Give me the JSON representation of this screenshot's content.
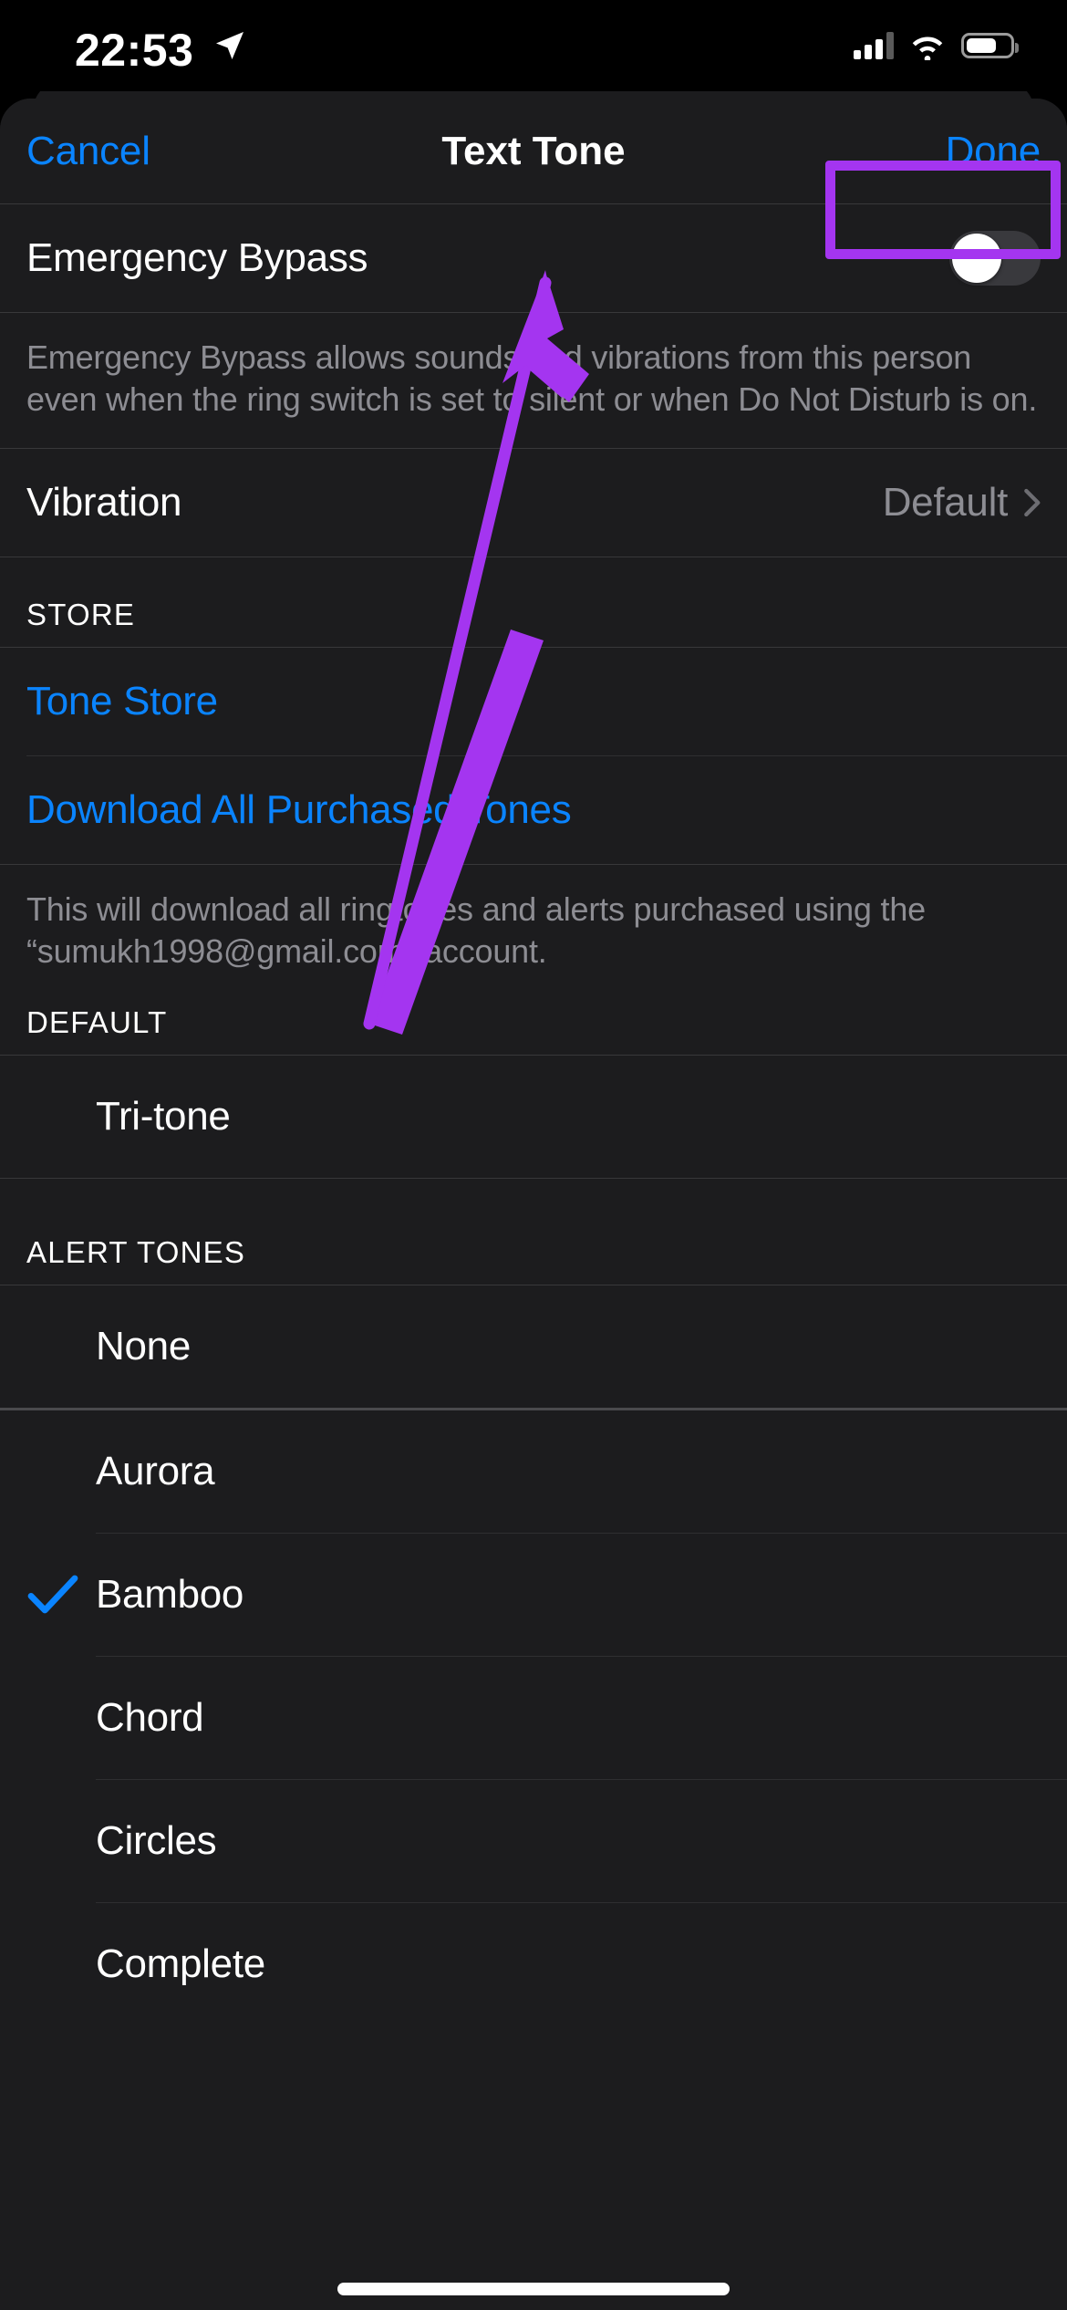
{
  "status_bar": {
    "time": "22:53",
    "location_icon": "location-arrow-icon",
    "cellular_icon": "cellular-bars-icon",
    "wifi_icon": "wifi-icon",
    "battery_icon": "battery-icon"
  },
  "nav": {
    "cancel_label": "Cancel",
    "title": "Text Tone",
    "done_label": "Done"
  },
  "emergency": {
    "label": "Emergency Bypass",
    "toggle_state": "off",
    "footer": "Emergency Bypass allows sounds and vibrations from this person even when the ring switch is set to silent or when Do Not Disturb is on."
  },
  "vibration": {
    "label": "Vibration",
    "value": "Default",
    "chevron_icon": "chevron-right-icon"
  },
  "store": {
    "header": "STORE",
    "tone_store_label": "Tone Store",
    "download_all_label": "Download All Purchased Tones",
    "footer": "This will download all ringtones and alerts purchased using the “sumukh1998@gmail.com” account."
  },
  "default_section": {
    "header": "DEFAULT",
    "items": [
      {
        "label": "Tri-tone",
        "selected": false
      }
    ]
  },
  "alert_tones": {
    "header": "ALERT TONES",
    "none_label": "None",
    "items": [
      {
        "label": "Aurora",
        "selected": false
      },
      {
        "label": "Bamboo",
        "selected": true
      },
      {
        "label": "Chord",
        "selected": false
      },
      {
        "label": "Circles",
        "selected": false
      },
      {
        "label": "Complete",
        "selected": false
      }
    ]
  },
  "annotation": {
    "highlight_target": "Done",
    "arrow_color": "#a435f0",
    "box_color": "#a435f0"
  },
  "colors": {
    "accent_blue": "#0a84ff",
    "background": "#1c1c1e",
    "secondary_text": "#8d8d93",
    "annotation_purple": "#a435f0"
  }
}
